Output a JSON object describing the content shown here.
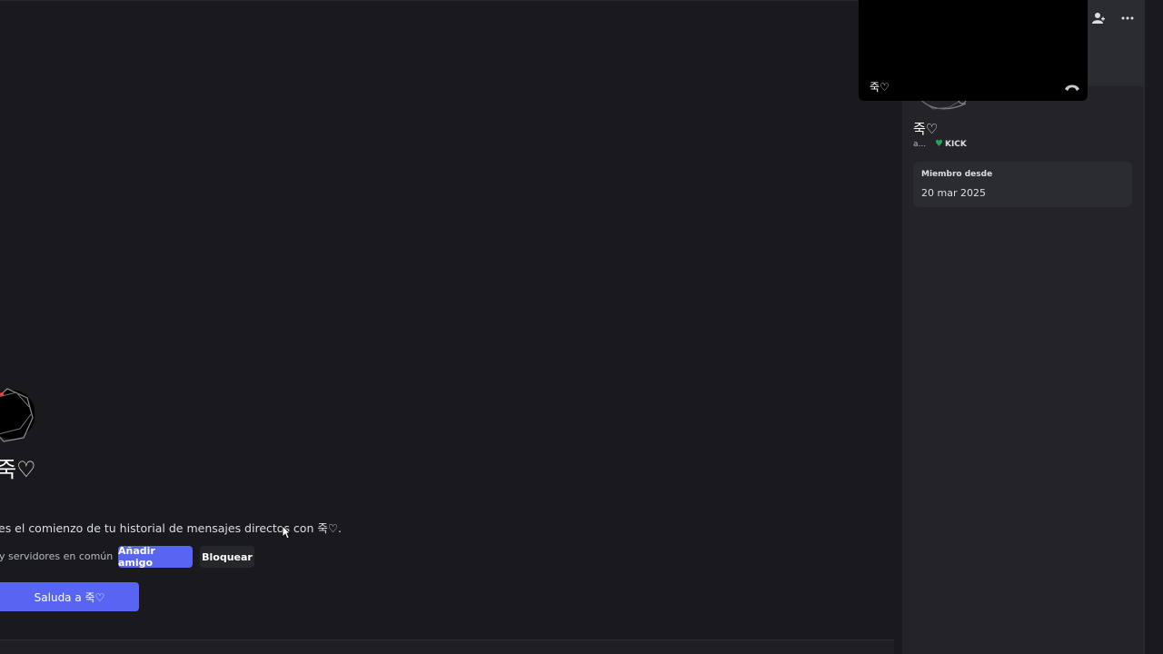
{
  "dm": {
    "name": "죽♡",
    "intro_text": "es el comienzo de tu historial de mensajes directos con 죽♡.",
    "common_servers": "y servidores en común",
    "add_friend": "Añadir amigo",
    "block": "Bloquear",
    "wave": "Saluda a 죽♡"
  },
  "profile": {
    "name": "죽♡",
    "handle": "a...",
    "tag": "KICK",
    "member_since_label": "Miembro desde",
    "member_since_date": "20 mar 2025"
  },
  "call": {
    "name": "죽♡"
  },
  "icons": {
    "add_friend": "person-add-icon",
    "more": "more-horizontal-icon",
    "hangup": "phone-hangup-icon",
    "tag": "heart-icon"
  },
  "colors": {
    "accent": "#5865f2",
    "background": "#1a1a1e",
    "panel": "#232328",
    "green": "#23a55a"
  }
}
